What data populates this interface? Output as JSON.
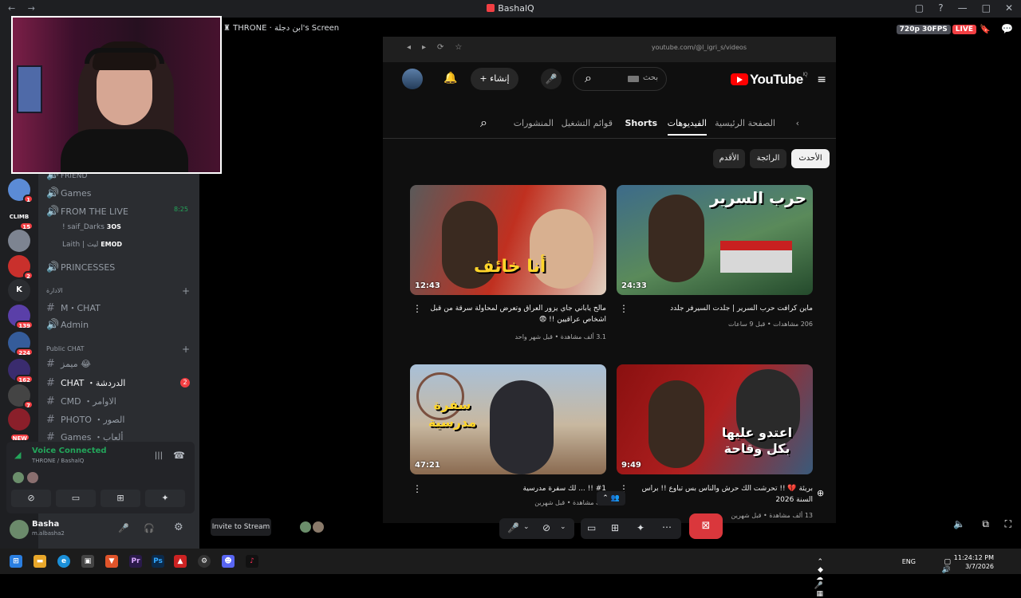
{
  "titlebar": {
    "title": "BashalQ",
    "nav": "← →",
    "controls": [
      "▢",
      "?",
      "—",
      "□",
      "✕"
    ]
  },
  "stage": {
    "header_name": "THRONE",
    "header_screen": "ابن دجلة's Screen",
    "quality": "720p 30FPS",
    "live": "LIVE"
  },
  "servers": [
    {
      "label": "",
      "badge": "1",
      "color": "#5b8bd6"
    },
    {
      "label": "CLIMB",
      "badge": "15",
      "color": "#1e1f22"
    },
    {
      "label": "",
      "badge": "",
      "color": "#7d8491"
    },
    {
      "label": "",
      "badge": "2",
      "color": "#c9302c"
    },
    {
      "label": "K",
      "badge": "",
      "color": "#2b2d31"
    },
    {
      "label": "",
      "badge": "139",
      "color": "#5a3fa8"
    },
    {
      "label": "",
      "badge": "224",
      "color": "#355c9a"
    },
    {
      "label": "",
      "badge": "162",
      "color": "#3a2c6e"
    },
    {
      "label": "",
      "badge": "7",
      "color": "#444"
    },
    {
      "label": "",
      "badge": "NEW",
      "color": "#8a1f2a"
    }
  ],
  "channels": {
    "friend": "FRIEND",
    "games_voice": "Games",
    "from_live": "FROM THE LIVE",
    "from_live_time": "8:25",
    "member1": "! saif_Darks",
    "member1_tag": "3OS",
    "member2": "Laith | ليث",
    "member2_tag": "EMOD",
    "princesses": "PRINCESSES",
    "cat_admin": "الادارة",
    "m_chat": "M・CHAT",
    "admin": "Admin",
    "cat_public": "Public CHAT",
    "memes": "ميمز 😂",
    "chat": "CHAT ・الدردشة",
    "chat_badge": "2",
    "cmd": "CMD ・الاوامر",
    "photo": "PHOTO ・الصور",
    "games_text": "Games ・ألعاب"
  },
  "voice_panel": {
    "status": "Voice Connected",
    "server": "THRONE / BashalQ"
  },
  "user": {
    "name": "Basha",
    "tag": "m.albasha2"
  },
  "invite": "Invite to Stream",
  "browser": {
    "url": "youtube.com/@l_igri_s/videos"
  },
  "youtube": {
    "logo": "YouTube",
    "logo_region": "IQ",
    "search_placeholder": "بحث",
    "create_label": "إنشاء",
    "tabs": [
      "الصفحة الرئيسية",
      "الفيديوهات",
      "Shorts",
      "قوائم التشغيل",
      "المنشورات"
    ],
    "chips": [
      "الأحدث",
      "الرائجة",
      "الأقدم"
    ],
    "videos": [
      {
        "duration": "24:33",
        "caption": "حرب السرير",
        "title": "ماين كرافت حرب السرير | جلدت السيرفر جلدد",
        "meta": "206 مشاهدات • قبل 9 ساعات",
        "colors": [
          "#3d6b8a",
          "#244a2c"
        ]
      },
      {
        "duration": "12:43",
        "caption": "أنا خائف",
        "title": "مالح ياباني جاي يزور العراق وتعرض لمحاولة سرقة من قبل اشخاص عراقيين !! 😨",
        "meta": "3.1 ألف مشاهدة • قبل شهر واحد",
        "colors": [
          "#b32a20",
          "#e0d0c0"
        ]
      },
      {
        "duration": "9:49",
        "caption": "اعتدو عليها بكل وقاحة",
        "title": "بريئة 💔 !! تحرشت الك حرش والناس بس تباوع !! براس السنة 2026",
        "meta": "13 ألف مشاهدة • قبل شهرين",
        "colors": [
          "#8a1010",
          "#3a5a7a"
        ]
      },
      {
        "duration": "47:21",
        "caption": "سفرة مدرسية",
        "title": "#1 !! ... لك سفرة مدرسية",
        "meta": "ألف مشاهدة • قبل شهرين",
        "colors": [
          "#a8c0d8",
          "#8a6a50"
        ]
      }
    ]
  },
  "taskbar": {
    "time": "11:24:12 PM",
    "date": "3/7/2026",
    "lang": "ENG"
  }
}
